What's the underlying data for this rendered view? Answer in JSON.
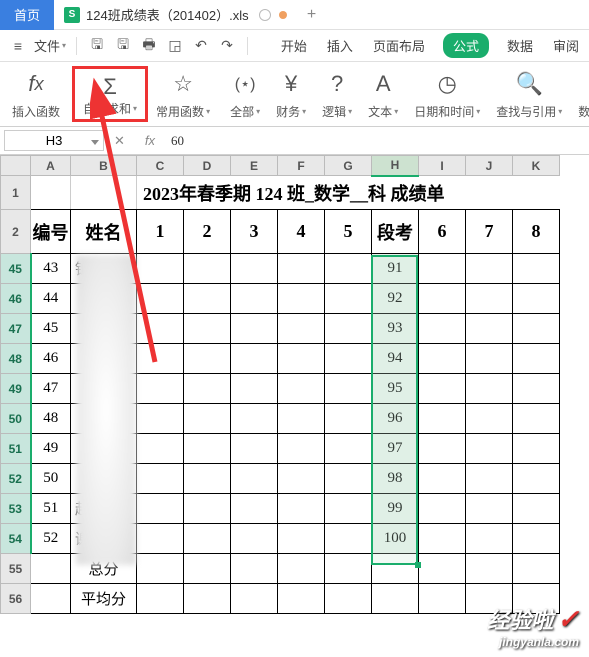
{
  "titlebar": {
    "home": "首页",
    "doc": "124班成绩表（201402）.xls",
    "new": "+"
  },
  "menubar": {
    "file": "文件",
    "tabs": {
      "start": "开始",
      "insert": "插入",
      "layout": "页面布局",
      "formula": "公式",
      "data": "数据",
      "review": "审阅"
    }
  },
  "ribbon": {
    "insert_fn": "插入函数",
    "autosum": "自动求和",
    "common": "常用函数",
    "all": "全部",
    "finance": "财务",
    "logic": "逻辑",
    "text": "文本",
    "datetime": "日期和时间",
    "lookup": "查找与引用",
    "math": "数学和三"
  },
  "formula_bar": {
    "cell": "H3",
    "value": "60"
  },
  "columns": [
    "A",
    "B",
    "C",
    "D",
    "E",
    "F",
    "G",
    "H",
    "I",
    "J",
    "K"
  ],
  "title_row": "2023年春季期 124 班_数学__科 成绩单",
  "headers": {
    "c0": "编号",
    "c1": "姓名",
    "c2": "1",
    "c3": "2",
    "c4": "3",
    "c5": "4",
    "c6": "5",
    "c7": "段考",
    "c8": "6",
    "c9": "7",
    "c10": "8"
  },
  "rows": [
    {
      "rh": "45",
      "id": "43",
      "name": "钺",
      "h": "91"
    },
    {
      "rh": "46",
      "id": "44",
      "name": "",
      "h": "92"
    },
    {
      "rh": "47",
      "id": "45",
      "name": "",
      "h": "93"
    },
    {
      "rh": "48",
      "id": "46",
      "name": "",
      "h": "94"
    },
    {
      "rh": "49",
      "id": "47",
      "name": "",
      "h": "95"
    },
    {
      "rh": "50",
      "id": "48",
      "name": "",
      "h": "96"
    },
    {
      "rh": "51",
      "id": "49",
      "name": "",
      "h": "97"
    },
    {
      "rh": "52",
      "id": "50",
      "name": "",
      "h": "98"
    },
    {
      "rh": "53",
      "id": "51",
      "name": "赵",
      "h": "99"
    },
    {
      "rh": "54",
      "id": "52",
      "name": "谢",
      "h": "100"
    }
  ],
  "footer": {
    "r55": "55",
    "r56": "56",
    "total": "总分",
    "avg": "平均分"
  },
  "watermark": {
    "main": "经验啦",
    "sub": "jingyanla.com"
  }
}
